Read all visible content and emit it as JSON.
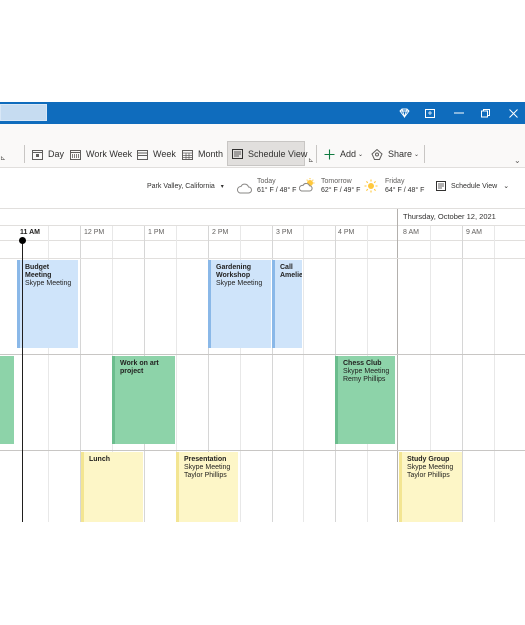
{
  "ribbon": {
    "day": "Day",
    "work_week": "Work Week",
    "week": "Week",
    "month": "Month",
    "schedule_view": "Schedule View",
    "add": "Add",
    "share": "Share"
  },
  "infobar": {
    "location": "Park Valley, California",
    "weather": [
      {
        "day": "Today",
        "temp": "61° F / 48° F",
        "icon": "cloud-icon"
      },
      {
        "day": "Tomorrow",
        "temp": "62° F / 49° F",
        "icon": "partly-sunny-icon"
      },
      {
        "day": "Friday",
        "temp": "64° F / 48° F",
        "icon": "sun-icon"
      }
    ],
    "view_selector": "Schedule View"
  },
  "calendar": {
    "next_date": "Thursday, October 12, 2021",
    "time_labels": [
      "11 AM",
      "12 PM",
      "1 PM",
      "2 PM",
      "3 PM",
      "4 PM",
      "8 AM",
      "9 AM"
    ],
    "events": [
      {
        "title": "Budget Meeting",
        "sub": [
          "Skype Meeting"
        ],
        "color": "blue"
      },
      {
        "title": "Gardening Workshop",
        "sub": [
          "Skype Meeting"
        ],
        "color": "blue"
      },
      {
        "title": "Call Amelie",
        "sub": [],
        "color": "blue"
      },
      {
        "title": "Work on art project",
        "sub": [],
        "color": "green"
      },
      {
        "title": "Chess Club",
        "sub": [
          "Skype Meeting",
          "Remy Phillips"
        ],
        "color": "green"
      },
      {
        "title": "Lunch",
        "sub": [],
        "color": "yellow"
      },
      {
        "title": "Presentation",
        "sub": [
          "Skype Meeting",
          "Taylor Phillips"
        ],
        "color": "yellow"
      },
      {
        "title": "Study Group",
        "sub": [
          "Skype Meeting",
          "Taylor Phillips"
        ],
        "color": "yellow"
      }
    ]
  },
  "colors": {
    "accent": "#0f6cbd",
    "event_blue": "#cfe4fa",
    "event_green": "#8dd3a9",
    "event_yellow": "#fdf6c7"
  }
}
